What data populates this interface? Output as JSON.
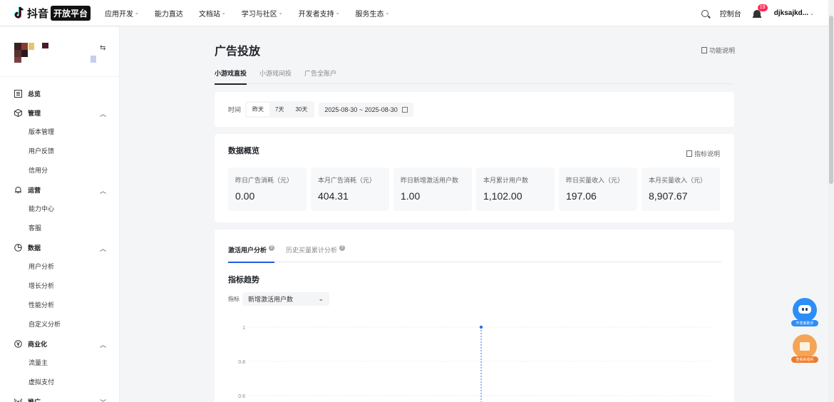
{
  "brand": {
    "name": "抖音",
    "badge": "开放平台"
  },
  "nav": [
    {
      "label": "应用开发",
      "caret": true
    },
    {
      "label": "能力直达",
      "caret": false
    },
    {
      "label": "文档站",
      "caret": true
    },
    {
      "label": "学习与社区",
      "caret": true
    },
    {
      "label": "开发者支持",
      "caret": true
    },
    {
      "label": "服务生态",
      "caret": true
    }
  ],
  "header": {
    "console": "控制台",
    "notifications": "19",
    "username": "djksajkd..."
  },
  "sidebar": {
    "groups": [
      {
        "label": "总览",
        "icon": "overview-icon",
        "chevron": "",
        "items": []
      },
      {
        "label": "管理",
        "icon": "box-icon",
        "chevron": "up",
        "items": [
          "版本管理",
          "用户反馈",
          "信用分"
        ]
      },
      {
        "label": "运营",
        "icon": "bell-icon",
        "chevron": "up",
        "items": [
          "能力中心",
          "客服"
        ]
      },
      {
        "label": "数据",
        "icon": "pie-icon",
        "chevron": "up",
        "items": [
          "用户分析",
          "增长分析",
          "性能分析",
          "自定义分析"
        ]
      },
      {
        "label": "商业化",
        "icon": "yuan-icon",
        "chevron": "up",
        "items": [
          "流量主",
          "虚拟支付"
        ]
      },
      {
        "label": "推广",
        "icon": "broadcast-icon",
        "chevron": "down",
        "items": []
      }
    ]
  },
  "page": {
    "title": "广告投放",
    "func_desc": "功能说明",
    "tabs": [
      "小游戏直投",
      "小游戏间投",
      "广告全账户"
    ],
    "filter": {
      "label": "时间",
      "ranges": [
        "昨天",
        "7天",
        "30天"
      ],
      "date_range": "2025-08-30 ~ 2025-08-30"
    },
    "overview": {
      "title": "数据概览",
      "metric_desc": "指标说明",
      "metrics": [
        {
          "label": "昨日广告消耗（元）",
          "value": "0.00"
        },
        {
          "label": "本月广告消耗（元）",
          "value": "404.31"
        },
        {
          "label": "昨日新增激活用户数",
          "value": "1.00"
        },
        {
          "label": "本月累计用户数",
          "value": "1,102.00"
        },
        {
          "label": "昨日买量收入（元）",
          "value": "197.06"
        },
        {
          "label": "本月买量收入（元）",
          "value": "8,907.67"
        }
      ]
    },
    "analysis": {
      "tabs": [
        "激活用户分析",
        "历史买量累计分析"
      ],
      "trend_title": "指标趋势",
      "indicator_label": "指标",
      "indicator_value": "新增激活用户数"
    }
  },
  "chart_data": {
    "type": "line",
    "y_ticks": [
      "1",
      "0.8",
      "0.6"
    ],
    "ylim": [
      0,
      1
    ],
    "points": [
      {
        "y": 1
      }
    ]
  },
  "floating": {
    "assistant": "开发者助手",
    "gift": "查看新福利"
  },
  "colors": {
    "accent": "#1e5be0",
    "badge": "#fe2c55",
    "robot": "#2c8ef8",
    "gift": "#f5a455"
  }
}
